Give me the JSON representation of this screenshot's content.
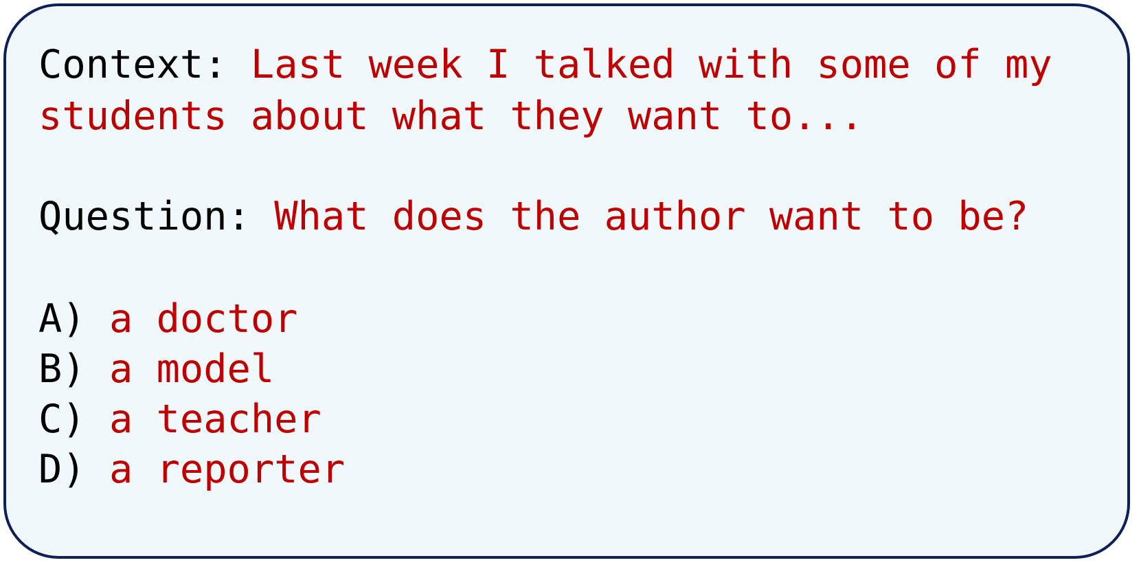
{
  "colors": {
    "label": "#000000",
    "value": "#c00000",
    "border": "#0f1f5c",
    "background": "#f1f8fb"
  },
  "context": {
    "label": "Context:",
    "line1": "Last week I talked with some of my",
    "line2": "students about what they want to..."
  },
  "question": {
    "label": "Question:",
    "text": "What does the author want to be?"
  },
  "options": [
    {
      "letter": "A)",
      "text": "a doctor"
    },
    {
      "letter": "B)",
      "text": "a model"
    },
    {
      "letter": "C)",
      "text": "a teacher"
    },
    {
      "letter": "D)",
      "text": "a reporter"
    }
  ]
}
